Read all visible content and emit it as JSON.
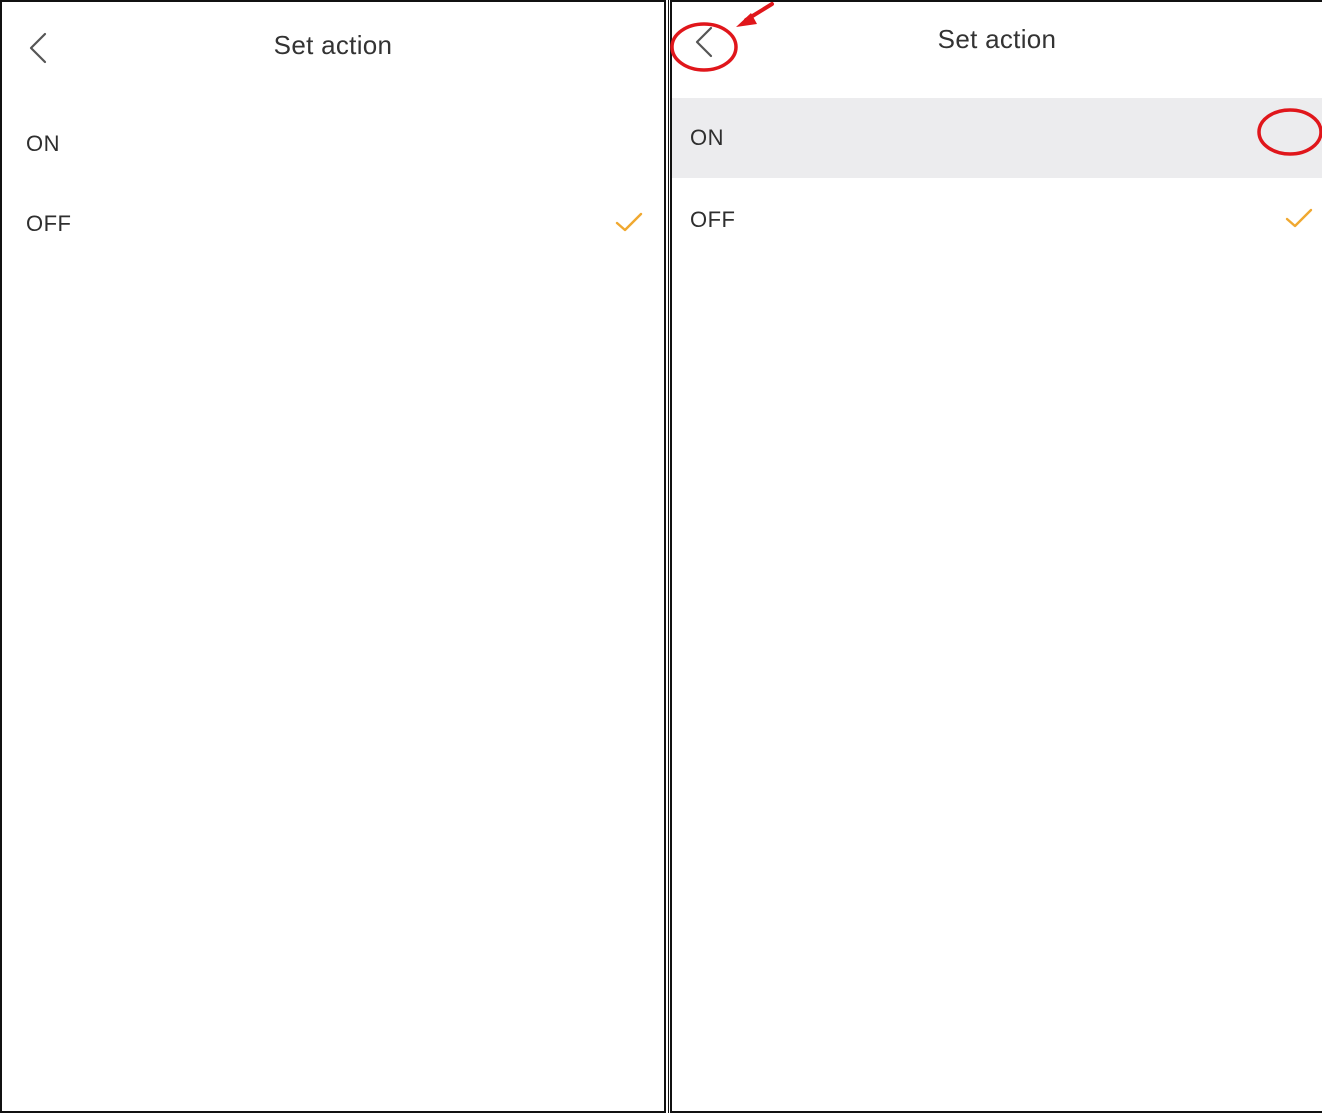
{
  "left_screen": {
    "title": "Set action",
    "options": [
      {
        "label": "ON",
        "selected": false
      },
      {
        "label": "OFF",
        "selected": true
      }
    ]
  },
  "right_screen": {
    "title": "Set action",
    "options": [
      {
        "label": "ON",
        "selected": false,
        "highlighted": true
      },
      {
        "label": "OFF",
        "selected": true
      }
    ]
  },
  "icons": {
    "back": "chevron-left-icon",
    "check": "checkmark-icon"
  },
  "colors": {
    "check": "#f0a830",
    "highlight_row": "#ececee",
    "annotation": "#e0161b",
    "text": "#333333"
  }
}
